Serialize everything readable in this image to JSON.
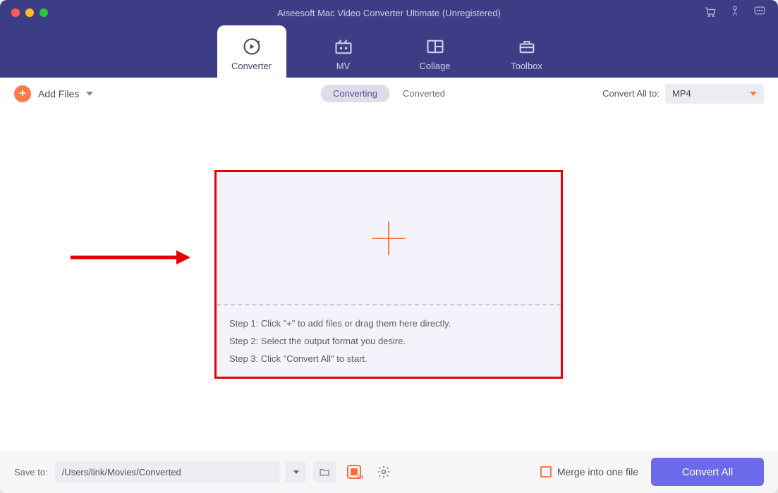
{
  "colors": {
    "accent_orange": "#ff7a4a",
    "header_bg": "#3d3d85",
    "primary_button": "#6b6aea",
    "annotation": "#e60000"
  },
  "window": {
    "title": "Aiseesoft Mac Video Converter Ultimate (Unregistered)"
  },
  "main_tabs": [
    {
      "label": "Converter",
      "icon": "converter-icon",
      "active": true
    },
    {
      "label": "MV",
      "icon": "mv-icon",
      "active": false
    },
    {
      "label": "Collage",
      "icon": "collage-icon",
      "active": false
    },
    {
      "label": "Toolbox",
      "icon": "toolbox-icon",
      "active": false
    }
  ],
  "toolbar": {
    "add_files_label": "Add Files",
    "segments": {
      "converting": "Converting",
      "converted": "Converted",
      "active": "converting"
    },
    "convert_all_to_label": "Convert All to:",
    "format_selected": "MP4"
  },
  "dropzone": {
    "step1": "Step 1: Click \"+\" to add files or drag them here directly.",
    "step2": "Step 2: Select the output format you desire.",
    "step3": "Step 3: Click \"Convert All\" to start."
  },
  "footer": {
    "save_to_label": "Save to:",
    "save_path": "/Users/link/Movies/Converted",
    "merge_label": "Merge into one file",
    "merge_checked": false,
    "convert_all_button": "Convert All"
  },
  "titlebar_icons": [
    "cart-icon",
    "register-icon",
    "feedback-icon"
  ]
}
